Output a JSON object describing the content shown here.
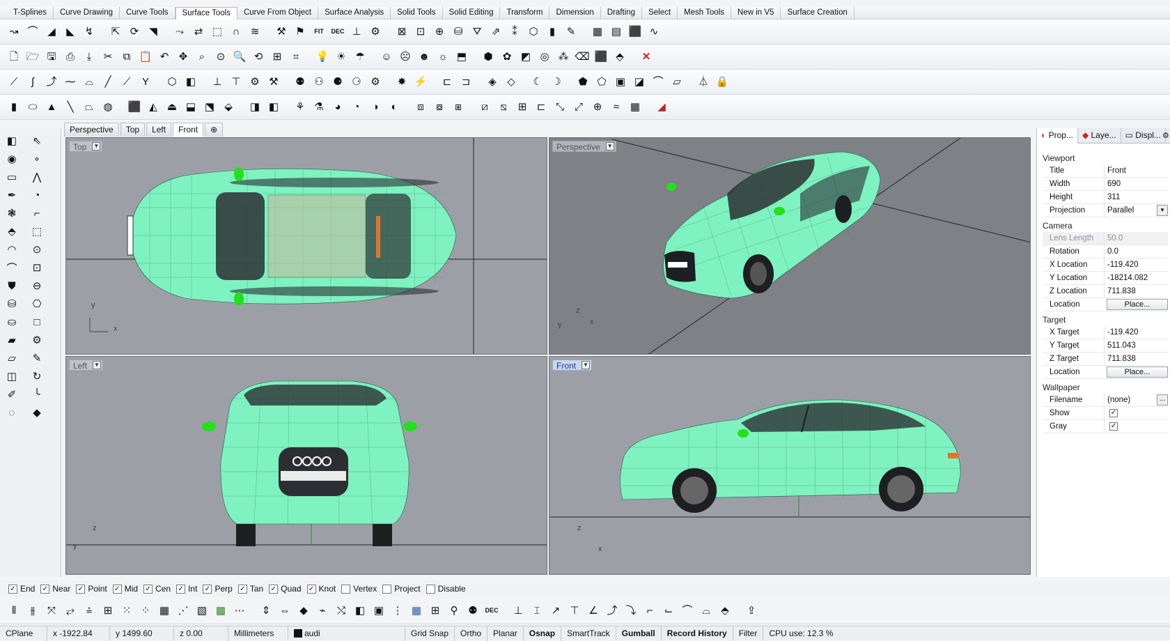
{
  "tabs": [
    "T-Splines",
    "Curve Drawing",
    "Curve Tools",
    "Surface Tools",
    "Curve From Object",
    "Surface Analysis",
    "Solid Tools",
    "Solid Editing",
    "Transform",
    "Dimension",
    "Drafting",
    "Select",
    "Mesh Tools",
    "New in V5",
    "Surface Creation"
  ],
  "active_tab": "Surface Tools",
  "toolbar_row1_icons": [
    "fillet-edge-icon",
    "blend-surface-icon",
    "offset-surface-icon",
    "extend-surface-icon",
    "fit-text-icon",
    "dec-text-icon"
  ],
  "toolbar_labels": {
    "fit": "FIT",
    "dec": "DEC"
  },
  "viewport_tabs": [
    "Perspective",
    "Top",
    "Left",
    "Front"
  ],
  "viewport_tab_active": "Front",
  "viewports": {
    "top": {
      "label": "Top",
      "axis_y": "y",
      "axis_x": "x"
    },
    "perspective": {
      "label": "Perspective",
      "axis_z": "z",
      "axis_y": "y",
      "axis_x": "x"
    },
    "left": {
      "label": "Left",
      "axis_z": "z",
      "axis_y": "y"
    },
    "front": {
      "label": "Front",
      "axis_z": "z",
      "axis_x": "x"
    }
  },
  "properties": {
    "tabs": [
      "Prop...",
      "Laye...",
      "Displ..."
    ],
    "viewport_section": "Viewport",
    "title_label": "Title",
    "title_value": "Front",
    "width_label": "Width",
    "width_value": "690",
    "height_label": "Height",
    "height_value": "311",
    "projection_label": "Projection",
    "projection_value": "Parallel",
    "camera_section": "Camera",
    "lens_label": "Lens Length",
    "lens_value": "50.0",
    "rotation_label": "Rotation",
    "rotation_value": "0.0",
    "xloc_label": "X Location",
    "xloc_value": "-119.420",
    "yloc_label": "Y Location",
    "yloc_value": "-18214.082",
    "zloc_label": "Z Location",
    "zloc_value": "711.838",
    "location_label": "Location",
    "place_button": "Place...",
    "target_section": "Target",
    "xtarget_label": "X Target",
    "xtarget_value": "-119.420",
    "ytarget_label": "Y Target",
    "ytarget_value": "511.043",
    "ztarget_label": "Z Target",
    "ztarget_value": "711.838",
    "target_location_label": "Location",
    "wallpaper_section": "Wallpaper",
    "filename_label": "Filename",
    "filename_value": "(none)",
    "browse_button": "...",
    "show_label": "Show",
    "gray_label": "Gray"
  },
  "osnap": [
    {
      "label": "End",
      "checked": true
    },
    {
      "label": "Near",
      "checked": true
    },
    {
      "label": "Point",
      "checked": true
    },
    {
      "label": "Mid",
      "checked": true
    },
    {
      "label": "Cen",
      "checked": true
    },
    {
      "label": "Int",
      "checked": true
    },
    {
      "label": "Perp",
      "checked": true
    },
    {
      "label": "Tan",
      "checked": true
    },
    {
      "label": "Quad",
      "checked": true
    },
    {
      "label": "Knot",
      "checked": true
    },
    {
      "label": "Vertex",
      "checked": false
    },
    {
      "label": "Project",
      "checked": false
    },
    {
      "label": "Disable",
      "checked": false
    }
  ],
  "status": {
    "cplane": "CPlane",
    "x": "x -1922.84",
    "y": "y 1499.60",
    "z": "z 0.00",
    "units": "Millimeters",
    "layer": "audi",
    "grid_snap": "Grid Snap",
    "ortho": "Ortho",
    "planar": "Planar",
    "osnap": "Osnap",
    "smarttrack": "SmartTrack",
    "gumball": "Gumball",
    "record_history": "Record History",
    "filter": "Filter",
    "cpu": "CPU use: 12.3 %"
  },
  "colors": {
    "viewport_bg": "#9ca0a6",
    "perspective_bg": "#7e8185",
    "car_mesh": "#7ef2c0",
    "mirror": "#22e01a",
    "active_label": "#c7d6f2"
  }
}
